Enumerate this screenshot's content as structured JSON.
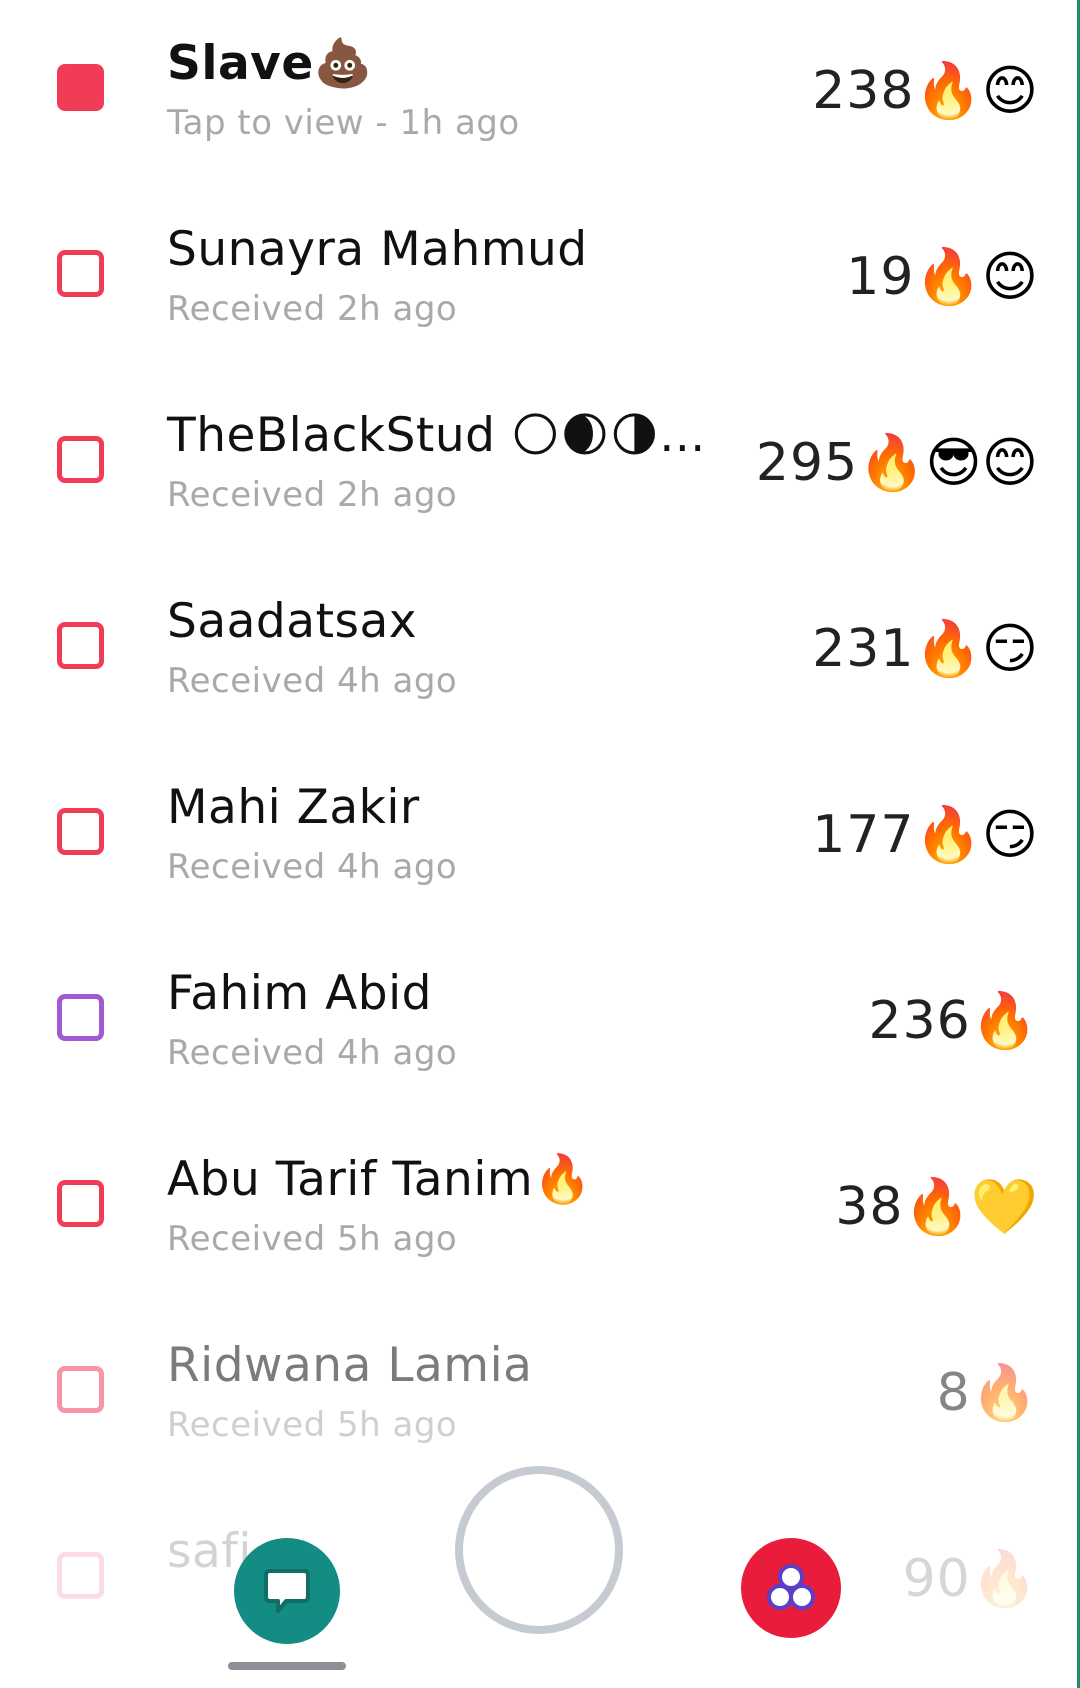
{
  "chats": [
    {
      "name": "Slave",
      "name_emoji": "💩",
      "status": "Tap to view - 1h ago",
      "count": "238",
      "emojis": "🔥😊",
      "box": "filled"
    },
    {
      "name": "Sunayra Mahmud",
      "name_emoji": "",
      "status": "Received 2h ago",
      "count": "19",
      "emojis": "🔥😊",
      "box": "outline"
    },
    {
      "name": "TheBlackStud",
      "name_emoji": "🌕🌒🌗...",
      "status": "Received 2h ago",
      "count": "295",
      "emojis": "🔥😎😊",
      "box": "outline"
    },
    {
      "name": "Saadatsax",
      "name_emoji": "",
      "status": "Received 4h ago",
      "count": "231",
      "emojis": "🔥😏",
      "box": "outline"
    },
    {
      "name": "Mahi Zakir",
      "name_emoji": "",
      "status": "Received 4h ago",
      "count": "177",
      "emojis": "🔥😏",
      "box": "outline"
    },
    {
      "name": "Fahim Abid",
      "name_emoji": "",
      "status": "Received 4h ago",
      "count": "236",
      "emojis": "🔥",
      "box": "purple"
    },
    {
      "name": "Abu Tarif Tanim",
      "name_emoji": "🔥",
      "status": "Received 5h ago",
      "count": "38",
      "emojis": "🔥💛",
      "box": "outline"
    },
    {
      "name": "Ridwana Lamia",
      "name_emoji": "",
      "status": "Received 5h ago",
      "count": "8",
      "emojis": "🔥",
      "box": "outline"
    },
    {
      "name": "safi",
      "name_emoji": "",
      "status": "",
      "count": "90",
      "emojis": "🔥",
      "box": "outline"
    }
  ],
  "nav": {
    "chat_icon": "chat-bubble-icon",
    "capture_icon": "capture-ring",
    "discover_icon": "discover-icon"
  },
  "colors": {
    "unopened": "#f23c57",
    "purple": "#a05ad2",
    "chat_nav": "#138c84",
    "discover_nav": "#e91d3b"
  }
}
